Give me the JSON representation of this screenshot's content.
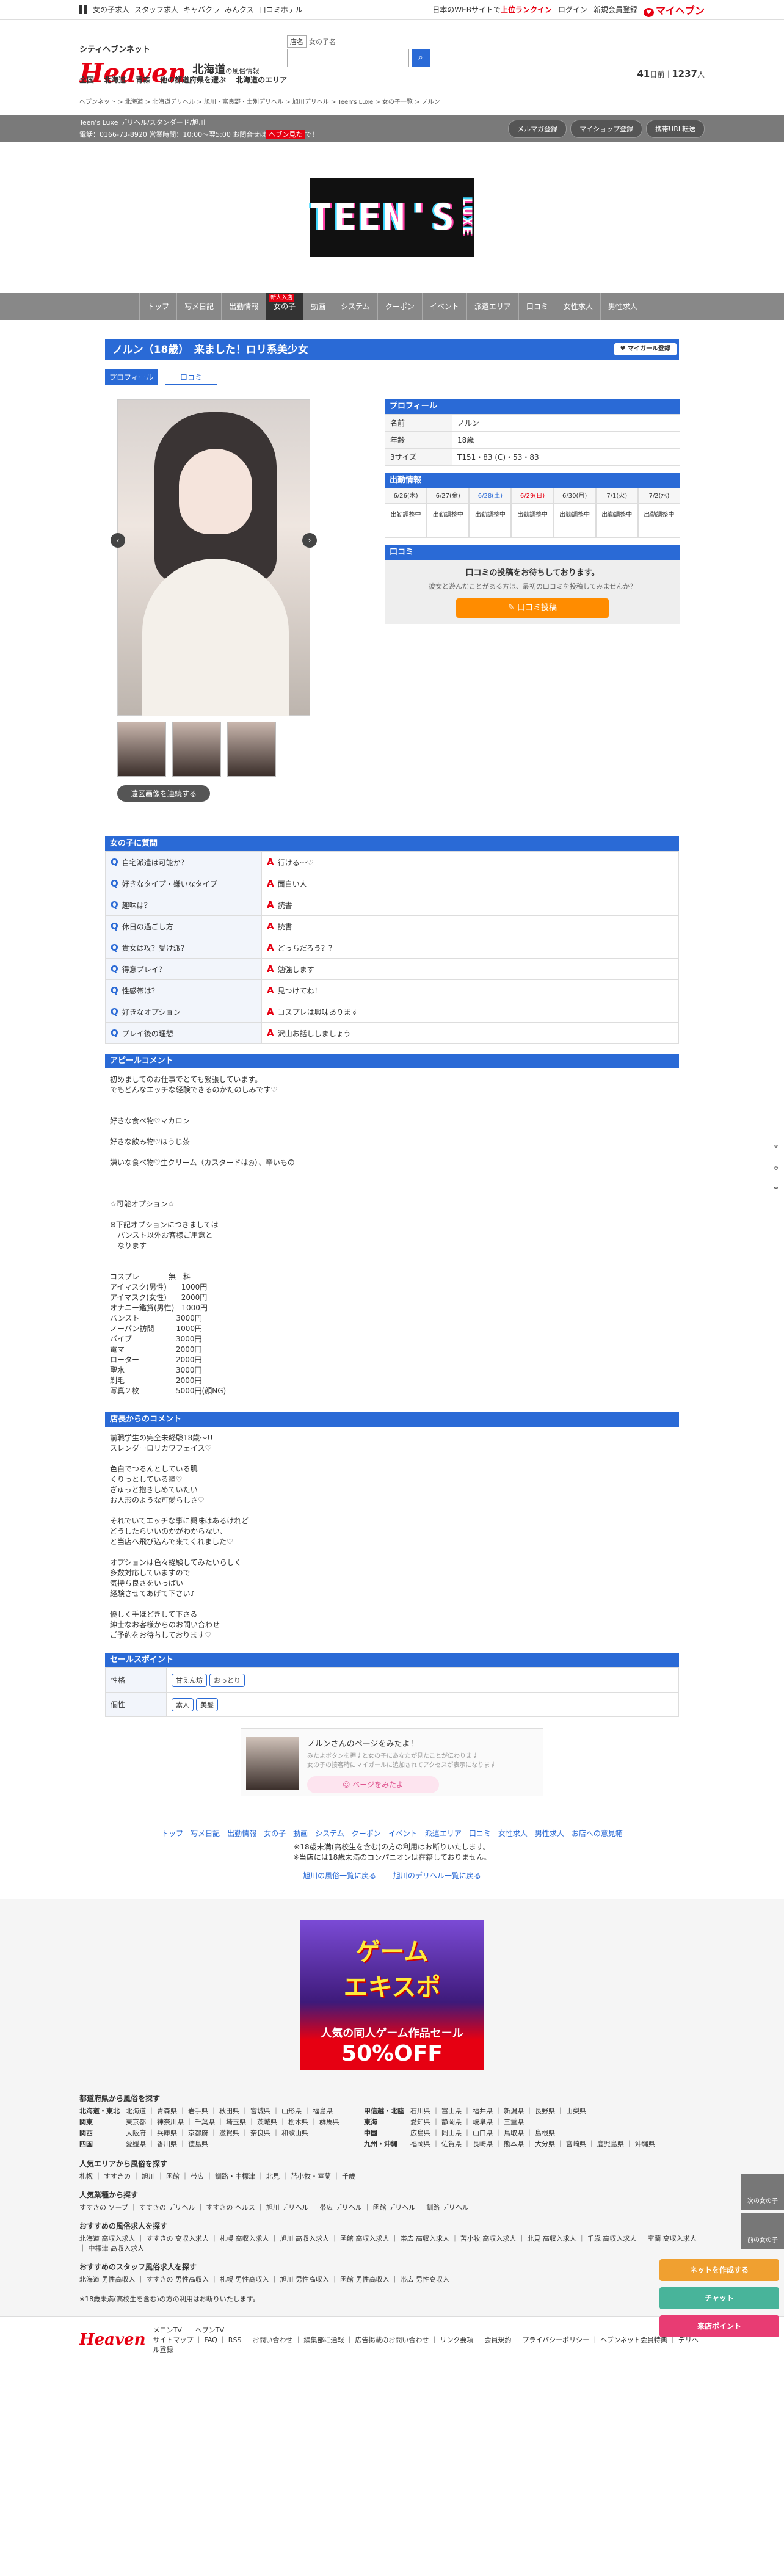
{
  "topbar": {
    "links": [
      "女の子求人",
      "スタッフ求人",
      "キャバクラ",
      "みんクス",
      "口コミホテル"
    ],
    "right_pre": "日本のWEBサイトで",
    "right_hl": "上位ランクイン",
    "login": "ログイン",
    "register": "新規会員登録",
    "myheaven": "マイヘブン"
  },
  "header": {
    "logo": "Heaven",
    "logo_sub": "シティヘブンネット",
    "region": "北海道",
    "region_sub": "の風俗情報",
    "search_label": "店名",
    "search_placeholder": "女の子名",
    "count1": "41",
    "count1_unit": "日前",
    "count2": "1237",
    "count2_unit": "人",
    "tabs": [
      "全国",
      "北海道",
      "青森",
      "他の都道府県を選ぶ",
      "北海道のエリア"
    ]
  },
  "shopbar": {
    "line1": "Teen's Luxe デリヘル/スタンダード/旭川",
    "line2": "電話：0166-73-8920 営業時間：10:00〜翌5:00 お問合せは",
    "line2_red": "ヘブン見た",
    "line2_end": "で！",
    "buttons": [
      "メルマガ登録",
      "マイショップ登録",
      "携帯URL転送"
    ]
  },
  "breadcrumb": "ヘブンネット > 北海道 > 北海道デリヘル > 旭川・富良野・士別デリヘル > 旭川デリヘル > Teen's Luxe > 女の子一覧 > ノルン",
  "banner": {
    "text": "TEEN'S",
    "side": "LUXE"
  },
  "shopnav": [
    "トップ",
    "写メ日記",
    "出勤情報",
    "女の子",
    "動画",
    "システム",
    "クーポン",
    "イベント",
    "派遣エリア",
    "口コミ",
    "女性求人",
    "男性求人"
  ],
  "girl": {
    "title": "ノルン（18歳）　来ました！ロリ系美少女",
    "mygirl": "マイガール登録",
    "tabs": [
      "プロフィール",
      "口コミ"
    ],
    "latest_btn": "遠区画像を連続する"
  },
  "profile": {
    "section": "プロフィール",
    "rows": [
      {
        "k": "名前",
        "v": "ノルン"
      },
      {
        "k": "年齢",
        "v": "18歳"
      },
      {
        "k": "3サイズ",
        "v": "T151・83 (C)・53・83"
      }
    ]
  },
  "schedule": {
    "section": "出勤情報",
    "days": [
      "6/26(木)",
      "6/27(金)",
      "6/28(土)",
      "6/29(日)",
      "6/30(月)",
      "7/1(火)",
      "7/2(水)"
    ],
    "status": "出勤調整中"
  },
  "kuchikomi": {
    "section": "口コミ",
    "title": "口コミの投稿をお待ちしております。",
    "text": "彼女と遊んだことがある方は、最初の口コミを投稿してみませんか？",
    "button": "口コミ投稿"
  },
  "qa": {
    "section": "女の子に質問",
    "rows": [
      {
        "q": "自宅派遣は可能か？",
        "a": "行ける〜♡"
      },
      {
        "q": "好きなタイプ・嫌いなタイプ",
        "a": "面白い人"
      },
      {
        "q": "趣味は？",
        "a": "読書"
      },
      {
        "q": "休日の過ごし方",
        "a": "読書"
      },
      {
        "q": "貴女は攻？受け派？",
        "a": "どっちだろう？？"
      },
      {
        "q": "得意プレイ？",
        "a": "勉強します"
      },
      {
        "q": "性感帯は？",
        "a": "見つけてね！"
      },
      {
        "q": "好きなオプション",
        "a": "コスプレは興味あります"
      },
      {
        "q": "プレイ後の理想",
        "a": "沢山お話ししましょう"
      }
    ]
  },
  "appeal": {
    "section": "アピールコメント",
    "text": "初めましてのお仕事でとても緊張しています。\nでもどんなエッチな経験できるのかたのしみです♡\n\n\n好きな食べ物♡マカロン\n\n好きな飲み物♡ほうじ茶\n\n嫌いな食べ物♡生クリーム（カスタードは◎）、辛いもの\n\n\n\n☆可能オプション☆\n\n※下記オプションにつきましては\n　パンスト以外お客様ご用意と\n　なります\n\n\nコスプレ　　　　無　料\nアイマスク(男性)　　1000円\nアイマスク(女性)　　2000円\nオナニー鑑賞(男性)　1000円\nパンスト　　　　　3000円\nノーパン訪問　　　1000円\nバイブ　　　　　　3000円\n電マ　　　　　　　2000円\nローター　　　　　2000円\n聖水　　　　　　　3000円\n剃毛　　　　　　　2000円\n写真２枚　　　　　5000円(顔NG)"
  },
  "shopcomment": {
    "section": "店長からのコメント",
    "text": "前職学生の完全未経験18歳〜!!\nスレンダーロリカワフェイス♡\n\n色白でつるんとしている肌\nくりっとしている瞳♡\nぎゅっと抱きしめていたい\nお人形のような可愛らしさ♡\n\nそれでいてエッチな事に興味はあるけれど\nどうしたらいいのかがわからない、\nと当店へ飛び込んで来てくれました♡\n\nオプションは色々経験してみたいらしく\n多数対応していますので\n気持ち良さをいっぱい\n経験させてあげて下さい♪\n\n優しく手ほどきして下さる\n紳士なお客様からのお問い合わせ\nご予約をお待ちしております♡"
  },
  "sales": {
    "section": "セールスポイント",
    "rows": [
      {
        "k": "性格",
        "tags": [
          "甘えん坊",
          "おっとり"
        ]
      },
      {
        "k": "個性",
        "tags": [
          "素人",
          "美髪"
        ]
      }
    ]
  },
  "share": {
    "title": "ノルンさんのページをみたよ！",
    "text": "みたよボタンを押すと女の子にあなたが見たことが伝わります\n女の子の接客時にマイガールに追加されてアクセスが表示になります",
    "button": "ページをみたよ"
  },
  "footnav": [
    "トップ",
    "写メ日記",
    "出勤情報",
    "女の子",
    "動画",
    "システム",
    "クーポン",
    "イベント",
    "派遣エリア",
    "口コミ",
    "女性求人",
    "男性求人",
    "お店への意見箱"
  ],
  "notes": [
    "※18歳未満(高校生を含む)の方の利用はお断りいたします。",
    "※当店には18歳未満のコンパニオンは在籍しておりません。"
  ],
  "ls_links": [
    "旭川の風俗一覧に戻る",
    "旭川のデリヘル一覧に戻る"
  ],
  "ad": {
    "big": "ゲーム\nエキスポ",
    "middle": "人気の同人ゲーム作品セール",
    "pct": "50%OFF"
  },
  "footer": {
    "h1": "都道府県から風俗を探す",
    "regions": [
      {
        "k": "北海道・東北",
        "v": "北海道 ｜ 青森県 ｜ 岩手県 ｜ 秋田県 ｜ 宮城県 ｜ 山形県 ｜ 福島県"
      },
      {
        "k": "関東",
        "v": "東京都 ｜ 神奈川県 ｜ 千葉県 ｜ 埼玉県 ｜ 茨城県 ｜ 栃木県 ｜ 群馬県"
      },
      {
        "k": "関西",
        "v": "大阪府 ｜ 兵庫県 ｜ 京都府 ｜ 滋賀県 ｜ 奈良県 ｜ 和歌山県"
      },
      {
        "k": "四国",
        "v": "愛媛県 ｜ 香川県 ｜ 徳島県"
      }
    ],
    "regions2": [
      {
        "k": "甲信越・北陸",
        "v": "石川県 ｜ 富山県 ｜ 福井県 ｜ 新潟県 ｜ 長野県 ｜ 山梨県"
      },
      {
        "k": "東海",
        "v": "愛知県 ｜ 静岡県 ｜ 岐阜県 ｜ 三重県"
      },
      {
        "k": "中国",
        "v": "広島県 ｜ 岡山県 ｜ 山口県 ｜ 鳥取県 ｜ 島根県"
      },
      {
        "k": "九州・沖縄",
        "v": "福岡県 ｜ 佐賀県 ｜ 長崎県 ｜ 熊本県 ｜ 大分県 ｜ 宮崎県 ｜ 鹿児島県 ｜ 沖縄県"
      }
    ],
    "h2": "人気エリアから風俗を探す",
    "l2": "札幌 ｜ すすきの ｜ 旭川 ｜ 函館 ｜ 帯広 ｜ 釧路・中標津 ｜ 北見 ｜ 苫小牧・室蘭 ｜ 千歳",
    "h3": "人気業種から探す",
    "l3": "すすきの ソープ ｜ すすきの デリヘル ｜ すすきの ヘルス ｜ 旭川 デリヘル ｜ 帯広 デリヘル ｜ 函館 デリヘル ｜ 釧路 デリヘル",
    "h4": "おすすめの風俗求人を探す",
    "l4": "北海道 高収入求人 ｜ すすきの 高収入求人 ｜ 札幌 高収入求人 ｜ 旭川 高収入求人 ｜ 函館 高収入求人 ｜ 帯広 高収入求人 ｜ 苫小牧 高収入求人 ｜ 北見 高収入求人 ｜ 千歳 高収入求人 ｜ 室蘭 高収入求人 ｜ 中標津 高収入求人",
    "h5": "おすすめのスタッフ風俗求人を探す",
    "l5": "北海道 男性高収入 ｜ すすきの 男性高収入 ｜ 札幌 男性高収入 ｜ 旭川 男性高収入 ｜ 函館 男性高収入 ｜ 帯広 男性高収入",
    "note": "※18歳未満(高校生を含む)の方の利用はお断りいたします。"
  },
  "bottom": {
    "logo": "Heaven",
    "line1": "メロンTV　　ヘブンTV",
    "line2": "サイトマップ ｜ FAQ ｜ RSS ｜ お問い合わせ ｜ 編集部に通報 ｜ 広告掲載のお問い合わせ ｜ リンク要項 ｜ 会員規約 ｜ プライバシーポリシー ｜ ヘブンネット会員特典 ｜ デリヘル登録"
  },
  "floating": {
    "next_girl": "次の女の子",
    "prev_girl": "前の女の子",
    "chat": "ネットを作成する",
    "chat2": "チャット",
    "point": "来店ポイント"
  }
}
